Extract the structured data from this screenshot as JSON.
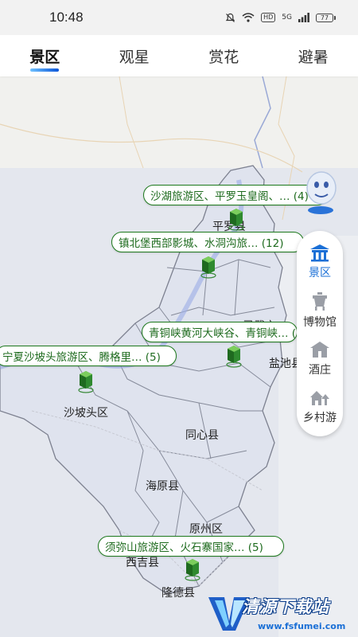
{
  "status_bar": {
    "time": "10:48",
    "battery": "77",
    "signal_label": "5G",
    "hd_label": "HD"
  },
  "tabs": [
    {
      "label": "景区",
      "active": true
    },
    {
      "label": "观星",
      "active": false
    },
    {
      "label": "赏花",
      "active": false
    },
    {
      "label": "避暑",
      "active": false
    }
  ],
  "map": {
    "labels": {
      "pingluo": "平罗县",
      "lingwu": "灵武市",
      "yanchi": "盐池县",
      "shapotou": "沙坡头区",
      "tongxin": "同心县",
      "haiyuan": "海原县",
      "yuanzhou": "原州区",
      "longde": "隆德县",
      "xiji": "西吉县"
    },
    "clusters": [
      {
        "text": "沙湖旅游区、平罗玉皇阁、… (4)"
      },
      {
        "text": "镇北堡西部影城、水洞沟旅… (12)"
      },
      {
        "text": "青铜峡黄河大峡谷、青铜峡… (5)"
      },
      {
        "text": "宁夏沙坡头旅游区、腾格里… (5)"
      },
      {
        "text": "须弥山旅游区、火石寨国家… (5)"
      }
    ]
  },
  "side_panel": {
    "items": [
      {
        "label": "景区",
        "icon": "scenic-icon",
        "active": true
      },
      {
        "label": "博物馆",
        "icon": "museum-icon",
        "active": false
      },
      {
        "label": "酒庄",
        "icon": "winery-icon",
        "active": false
      },
      {
        "label": "乡村游",
        "icon": "village-icon",
        "active": false
      }
    ]
  },
  "watermark": {
    "title": "清源下载站",
    "url": "www.fsfumei.com"
  },
  "colors": {
    "accent": "#1a6fd6",
    "cluster_green": "#1e7a1e",
    "region_fill": "#dfe3ee"
  }
}
